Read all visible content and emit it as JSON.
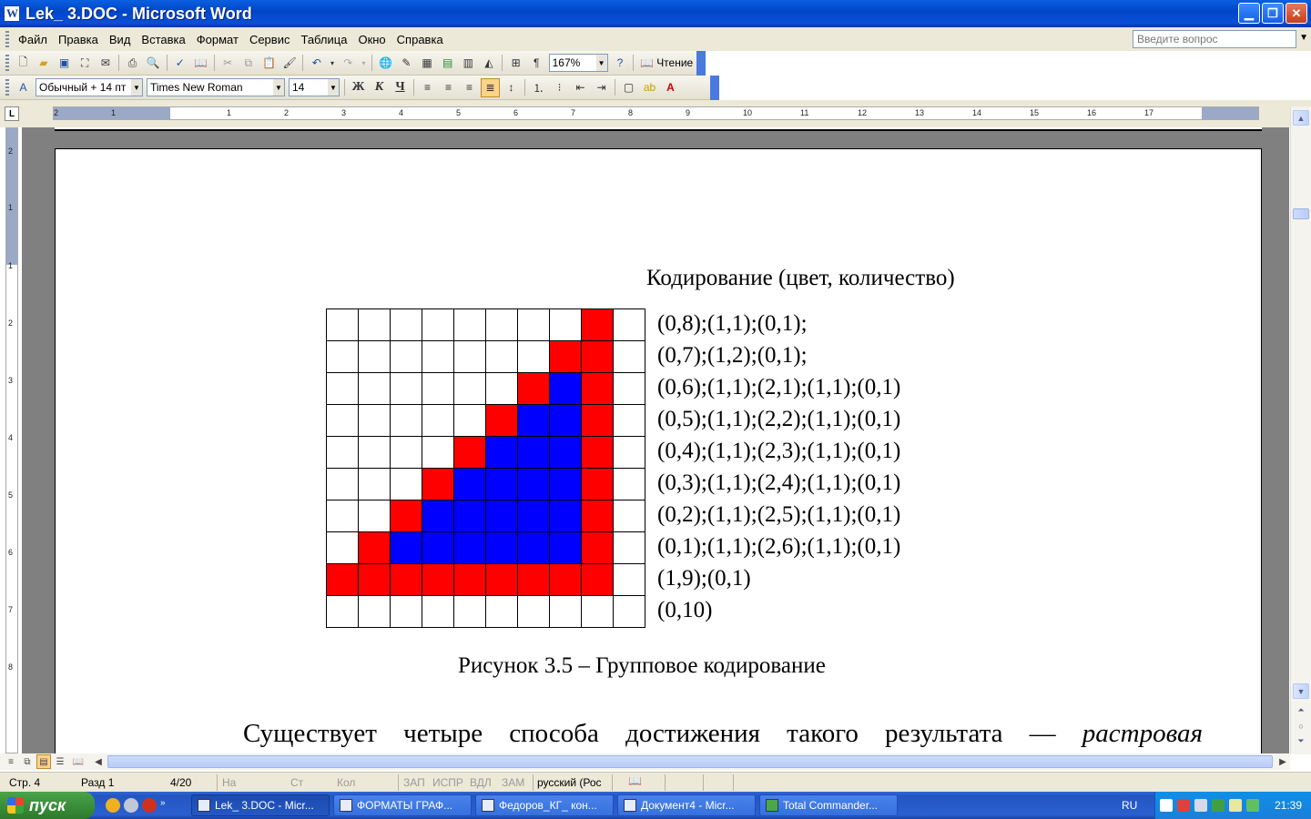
{
  "window": {
    "title": "Lek_ 3.DOC - Microsoft Word"
  },
  "menu": {
    "items": [
      "Файл",
      "Правка",
      "Вид",
      "Вставка",
      "Формат",
      "Сервис",
      "Таблица",
      "Окно",
      "Справка"
    ],
    "help_placeholder": "Введите вопрос"
  },
  "toolbar": {
    "zoom": "167%",
    "read_label": "Чтение",
    "style": "Обычный + 14 пт",
    "font": "Times New Roman",
    "size": "14",
    "bold": "Ж",
    "italic": "К",
    "underline": "Ч"
  },
  "ruler": {
    "h_numbers": [
      "2",
      "1",
      "1",
      "2",
      "3",
      "4",
      "5",
      "6",
      "7",
      "8",
      "9",
      "10",
      "11",
      "12",
      "13",
      "14",
      "15",
      "16",
      "17"
    ],
    "v_numbers": [
      "2",
      "1",
      "1",
      "2",
      "3",
      "4",
      "5",
      "6",
      "7",
      "8"
    ]
  },
  "document": {
    "header": "Кодирование (цвет, количество)",
    "colors": {
      "0": "#ffffff",
      "1": "#ff0000",
      "2": "#0000ff"
    },
    "grid": [
      [
        0,
        0,
        0,
        0,
        0,
        0,
        0,
        0,
        1,
        0
      ],
      [
        0,
        0,
        0,
        0,
        0,
        0,
        0,
        1,
        1,
        0
      ],
      [
        0,
        0,
        0,
        0,
        0,
        0,
        1,
        2,
        1,
        0
      ],
      [
        0,
        0,
        0,
        0,
        0,
        1,
        2,
        2,
        1,
        0
      ],
      [
        0,
        0,
        0,
        0,
        1,
        2,
        2,
        2,
        1,
        0
      ],
      [
        0,
        0,
        0,
        1,
        2,
        2,
        2,
        2,
        1,
        0
      ],
      [
        0,
        0,
        1,
        2,
        2,
        2,
        2,
        2,
        1,
        0
      ],
      [
        0,
        1,
        2,
        2,
        2,
        2,
        2,
        2,
        1,
        0
      ],
      [
        1,
        1,
        1,
        1,
        1,
        1,
        1,
        1,
        1,
        0
      ],
      [
        0,
        0,
        0,
        0,
        0,
        0,
        0,
        0,
        0,
        0
      ]
    ],
    "codes": [
      "(0,8);(1,1);(0,1);",
      "(0,7);(1,2);(0,1);",
      "(0,6);(1,1);(2,1);(1,1);(0,1)",
      "(0,5);(1,1);(2,2);(1,1);(0,1)",
      "(0,4);(1,1);(2,3);(1,1);(0,1)",
      "(0,3);(1,1);(2,4);(1,1);(0,1)",
      "(0,2);(1,1);(2,5);(1,1);(0,1)",
      "(0,1);(1,1);(2,6);(1,1);(0,1)",
      "(1,9);(0,1)",
      "(0,10)"
    ],
    "caption": "Рисунок 3.5 – Групповое кодирование",
    "body_words": [
      "Существует",
      "четыре",
      "способа",
      "достижения",
      "такого",
      "результата",
      "—"
    ],
    "body_italic": "растровая"
  },
  "status": {
    "page": "Стр. 4",
    "section": "Разд 1",
    "pages": "4/20",
    "at": "На",
    "line": "Ст",
    "col": "Кол",
    "rec": "ЗАП",
    "trk": "ИСПР",
    "ext": "ВДЛ",
    "ovr": "ЗАМ",
    "language": "русский (Рос"
  },
  "taskbar": {
    "start": "пуск",
    "tasks": [
      "Lek_ 3.DOC - Micr...",
      "ФОРМАТЫ ГРАФ...",
      "Федоров_КГ_ кон...",
      "Документ4 - Micr...",
      "Total Commander..."
    ],
    "lang": "RU",
    "clock": "21:39"
  }
}
